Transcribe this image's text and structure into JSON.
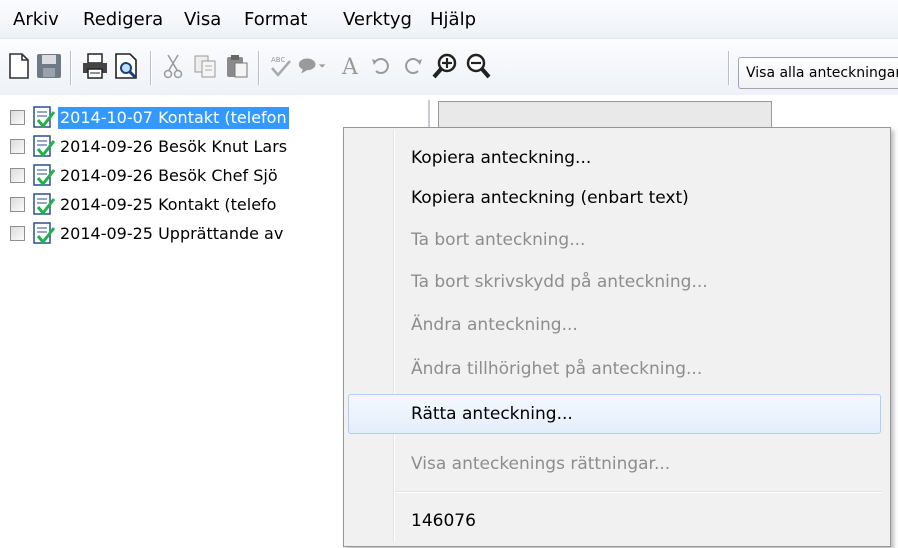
{
  "menubar": {
    "items": [
      "Arkiv",
      "Redigera",
      "Visa",
      "Format",
      "Verktyg",
      "Hjälp"
    ]
  },
  "toolbar": {
    "buttons": [
      "new-icon",
      "save-icon",
      "print-icon",
      "print-preview-icon",
      "cut-icon",
      "copy-icon",
      "paste-icon",
      "spellcheck-icon",
      "comment-icon",
      "font-icon",
      "undo-icon",
      "redo-icon",
      "zoom-in-icon",
      "zoom-out-icon"
    ],
    "filter_value": "Visa alla anteckningar"
  },
  "notes": [
    {
      "label": "2014-10-07 Kontakt (telefon",
      "selected": true
    },
    {
      "label": "2014-09-26 Besök Knut Lars",
      "selected": false
    },
    {
      "label": "2014-09-26 Besök Chef Sjö",
      "selected": false
    },
    {
      "label": "2014-09-25 Kontakt (telefo",
      "selected": false
    },
    {
      "label": "2014-09-25 Upprättande av",
      "selected": false
    }
  ],
  "context_menu": {
    "items": [
      {
        "label": "Kopiera anteckning...",
        "enabled": true
      },
      {
        "label": "Kopiera anteckning (enbart text)",
        "enabled": true
      },
      {
        "label": "Ta bort anteckning...",
        "enabled": false
      },
      {
        "label": "Ta bort skrivskydd på anteckning...",
        "enabled": false
      },
      {
        "label": "Ändra anteckning...",
        "enabled": false
      },
      {
        "label": "Ändra tillhörighet på anteckning...",
        "enabled": false
      },
      {
        "label": "Rätta anteckning...",
        "enabled": true,
        "highlighted": true
      },
      {
        "label": "Visa anteckenings rättningar...",
        "enabled": false
      }
    ],
    "footer_id": "146076"
  },
  "colors": {
    "selection": "#3399ff",
    "check_green": "#22b14c",
    "disabled_text": "#8d8d8d"
  }
}
